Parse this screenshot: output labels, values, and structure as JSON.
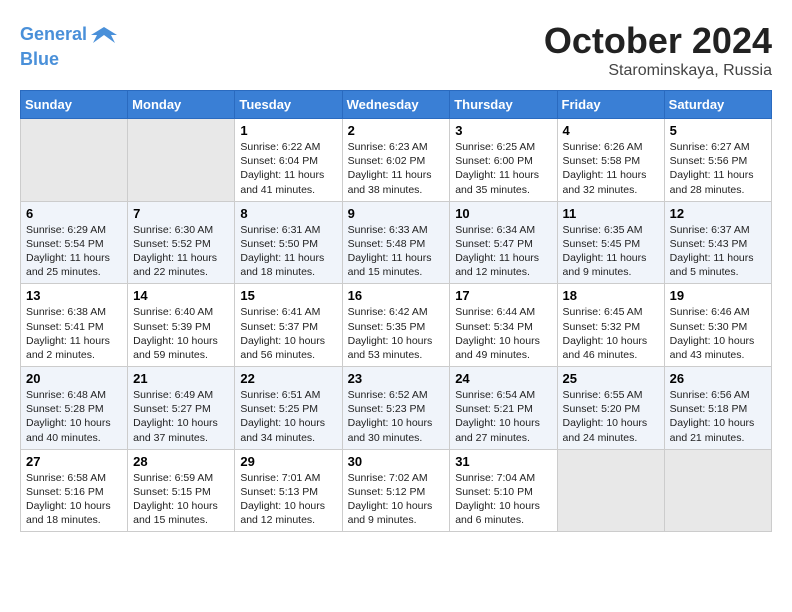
{
  "header": {
    "logo_line1": "General",
    "logo_line2": "Blue",
    "month": "October 2024",
    "location": "Starominskaya, Russia"
  },
  "weekdays": [
    "Sunday",
    "Monday",
    "Tuesday",
    "Wednesday",
    "Thursday",
    "Friday",
    "Saturday"
  ],
  "weeks": [
    [
      {
        "day": "",
        "empty": true
      },
      {
        "day": "",
        "empty": true
      },
      {
        "day": "1",
        "sunrise": "6:22 AM",
        "sunset": "6:04 PM",
        "daylight": "11 hours and 41 minutes."
      },
      {
        "day": "2",
        "sunrise": "6:23 AM",
        "sunset": "6:02 PM",
        "daylight": "11 hours and 38 minutes."
      },
      {
        "day": "3",
        "sunrise": "6:25 AM",
        "sunset": "6:00 PM",
        "daylight": "11 hours and 35 minutes."
      },
      {
        "day": "4",
        "sunrise": "6:26 AM",
        "sunset": "5:58 PM",
        "daylight": "11 hours and 32 minutes."
      },
      {
        "day": "5",
        "sunrise": "6:27 AM",
        "sunset": "5:56 PM",
        "daylight": "11 hours and 28 minutes."
      }
    ],
    [
      {
        "day": "6",
        "sunrise": "6:29 AM",
        "sunset": "5:54 PM",
        "daylight": "11 hours and 25 minutes."
      },
      {
        "day": "7",
        "sunrise": "6:30 AM",
        "sunset": "5:52 PM",
        "daylight": "11 hours and 22 minutes."
      },
      {
        "day": "8",
        "sunrise": "6:31 AM",
        "sunset": "5:50 PM",
        "daylight": "11 hours and 18 minutes."
      },
      {
        "day": "9",
        "sunrise": "6:33 AM",
        "sunset": "5:48 PM",
        "daylight": "11 hours and 15 minutes."
      },
      {
        "day": "10",
        "sunrise": "6:34 AM",
        "sunset": "5:47 PM",
        "daylight": "11 hours and 12 minutes."
      },
      {
        "day": "11",
        "sunrise": "6:35 AM",
        "sunset": "5:45 PM",
        "daylight": "11 hours and 9 minutes."
      },
      {
        "day": "12",
        "sunrise": "6:37 AM",
        "sunset": "5:43 PM",
        "daylight": "11 hours and 5 minutes."
      }
    ],
    [
      {
        "day": "13",
        "sunrise": "6:38 AM",
        "sunset": "5:41 PM",
        "daylight": "11 hours and 2 minutes."
      },
      {
        "day": "14",
        "sunrise": "6:40 AM",
        "sunset": "5:39 PM",
        "daylight": "10 hours and 59 minutes."
      },
      {
        "day": "15",
        "sunrise": "6:41 AM",
        "sunset": "5:37 PM",
        "daylight": "10 hours and 56 minutes."
      },
      {
        "day": "16",
        "sunrise": "6:42 AM",
        "sunset": "5:35 PM",
        "daylight": "10 hours and 53 minutes."
      },
      {
        "day": "17",
        "sunrise": "6:44 AM",
        "sunset": "5:34 PM",
        "daylight": "10 hours and 49 minutes."
      },
      {
        "day": "18",
        "sunrise": "6:45 AM",
        "sunset": "5:32 PM",
        "daylight": "10 hours and 46 minutes."
      },
      {
        "day": "19",
        "sunrise": "6:46 AM",
        "sunset": "5:30 PM",
        "daylight": "10 hours and 43 minutes."
      }
    ],
    [
      {
        "day": "20",
        "sunrise": "6:48 AM",
        "sunset": "5:28 PM",
        "daylight": "10 hours and 40 minutes."
      },
      {
        "day": "21",
        "sunrise": "6:49 AM",
        "sunset": "5:27 PM",
        "daylight": "10 hours and 37 minutes."
      },
      {
        "day": "22",
        "sunrise": "6:51 AM",
        "sunset": "5:25 PM",
        "daylight": "10 hours and 34 minutes."
      },
      {
        "day": "23",
        "sunrise": "6:52 AM",
        "sunset": "5:23 PM",
        "daylight": "10 hours and 30 minutes."
      },
      {
        "day": "24",
        "sunrise": "6:54 AM",
        "sunset": "5:21 PM",
        "daylight": "10 hours and 27 minutes."
      },
      {
        "day": "25",
        "sunrise": "6:55 AM",
        "sunset": "5:20 PM",
        "daylight": "10 hours and 24 minutes."
      },
      {
        "day": "26",
        "sunrise": "6:56 AM",
        "sunset": "5:18 PM",
        "daylight": "10 hours and 21 minutes."
      }
    ],
    [
      {
        "day": "27",
        "sunrise": "6:58 AM",
        "sunset": "5:16 PM",
        "daylight": "10 hours and 18 minutes."
      },
      {
        "day": "28",
        "sunrise": "6:59 AM",
        "sunset": "5:15 PM",
        "daylight": "10 hours and 15 minutes."
      },
      {
        "day": "29",
        "sunrise": "7:01 AM",
        "sunset": "5:13 PM",
        "daylight": "10 hours and 12 minutes."
      },
      {
        "day": "30",
        "sunrise": "7:02 AM",
        "sunset": "5:12 PM",
        "daylight": "10 hours and 9 minutes."
      },
      {
        "day": "31",
        "sunrise": "7:04 AM",
        "sunset": "5:10 PM",
        "daylight": "10 hours and 6 minutes."
      },
      {
        "day": "",
        "empty": true
      },
      {
        "day": "",
        "empty": true
      }
    ]
  ],
  "labels": {
    "sunrise": "Sunrise: ",
    "sunset": "Sunset: ",
    "daylight": "Daylight: "
  }
}
